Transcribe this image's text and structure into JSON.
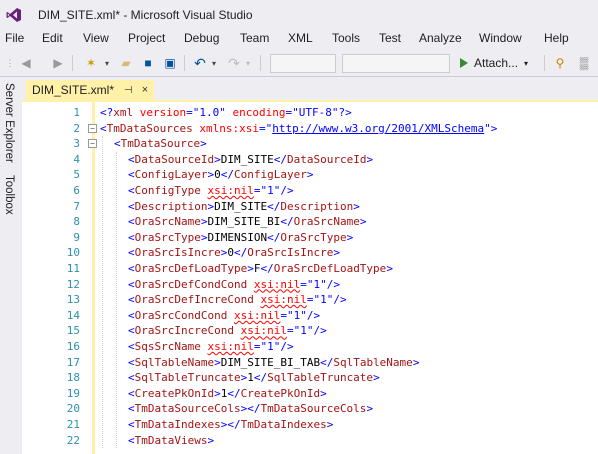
{
  "window": {
    "title": "DIM_SITE.xml* - Microsoft Visual Studio"
  },
  "menu": [
    "File",
    "Edit",
    "View",
    "Project",
    "Debug",
    "Team",
    "XML",
    "Tools",
    "Test",
    "Analyze",
    "Window",
    "Help"
  ],
  "toolbar": {
    "attach_label": "Attach..."
  },
  "sidebar": {
    "server_explorer": "Server Explorer",
    "toolbox": "Toolbox"
  },
  "tab": {
    "label": "DIM_SITE.xml*",
    "pin": "⊣",
    "close": "×"
  },
  "editor": {
    "lines": [
      {
        "n": "1",
        "indent": 0,
        "text": "<?xml version=\"1.0\" encoding=\"UTF-8\"?>"
      },
      {
        "n": "2",
        "indent": 0,
        "text": "<TmDataSources xmlns:xsi=\"http://www.w3.org/2001/XMLSchema\">"
      },
      {
        "n": "3",
        "indent": 1,
        "text": "<TmDataSource>"
      },
      {
        "n": "4",
        "indent": 2,
        "text": "<DataSourceId>DIM_SITE</DataSourceId>"
      },
      {
        "n": "5",
        "indent": 2,
        "text": "<ConfigLayer>0</ConfigLayer>"
      },
      {
        "n": "6",
        "indent": 2,
        "text": "<ConfigType xsi:nil=\"1\"/>"
      },
      {
        "n": "7",
        "indent": 2,
        "text": "<Description>DIM_SITE</Description>"
      },
      {
        "n": "8",
        "indent": 2,
        "text": "<OraSrcName>DIM_SITE_BI</OraSrcName>"
      },
      {
        "n": "9",
        "indent": 2,
        "text": "<OraSrcType>DIMENSION</OraSrcType>"
      },
      {
        "n": "10",
        "indent": 2,
        "text": "<OraSrcIsIncre>0</OraSrcIsIncre>"
      },
      {
        "n": "11",
        "indent": 2,
        "text": "<OraSrcDefLoadType>F</OraSrcDefLoadType>"
      },
      {
        "n": "12",
        "indent": 2,
        "text": "<OraSrcDefCondCond xsi:nil=\"1\"/>"
      },
      {
        "n": "13",
        "indent": 2,
        "text": "<OraSrcDefIncreCond xsi:nil=\"1\"/>"
      },
      {
        "n": "14",
        "indent": 2,
        "text": "<OraSrcCondCond xsi:nil=\"1\"/>"
      },
      {
        "n": "15",
        "indent": 2,
        "text": "<OraSrcIncreCond xsi:nil=\"1\"/>"
      },
      {
        "n": "16",
        "indent": 2,
        "text": "<SqsSrcName xsi:nil=\"1\"/>"
      },
      {
        "n": "17",
        "indent": 2,
        "text": "<SqlTableName>DIM_SITE_BI_TAB</SqlTableName>"
      },
      {
        "n": "18",
        "indent": 2,
        "text": "<SqlTableTruncate>1</SqlTableTruncate>"
      },
      {
        "n": "19",
        "indent": 2,
        "text": "<CreatePkOnId>1</CreatePkOnId>"
      },
      {
        "n": "20",
        "indent": 2,
        "text": "<TmDataSourceCols></TmDataSourceCols>"
      },
      {
        "n": "21",
        "indent": 2,
        "text": "<TmDataIndexes></TmDataIndexes>"
      },
      {
        "n": "22",
        "indent": 2,
        "text": "<TmDataViews>"
      }
    ]
  },
  "colors": {
    "keyword_blue": "#0000ff",
    "element_name": "#a31515",
    "attribute_red": "#ff0000",
    "line_number": "#2b91af",
    "tab_active": "#fff1a8",
    "run_green": "#388a34"
  }
}
